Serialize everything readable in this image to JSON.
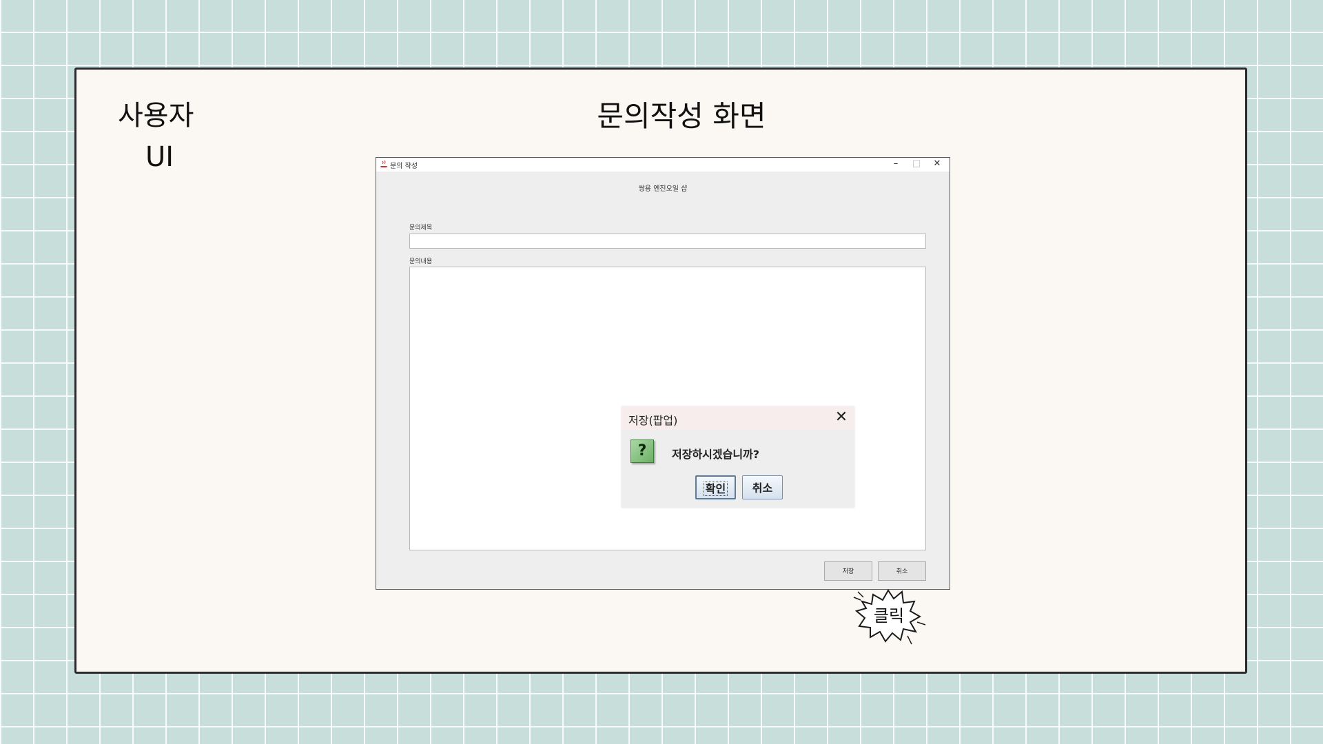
{
  "slide": {
    "label_line1": "사용자",
    "label_line2": "UI",
    "title": "문의작성 화면"
  },
  "window": {
    "title": "문의 작성",
    "controls": {
      "minimize": "–",
      "maximize": "□",
      "close": "✕"
    },
    "header": "쌍용 엔진오일 샵",
    "subject_label": "문의제목",
    "subject_value": "",
    "content_label": "문의내용",
    "content_value": "",
    "save_button": "저장",
    "cancel_button": "취소"
  },
  "dialog": {
    "title": "저장(팝업)",
    "close": "✕",
    "icon": "?",
    "message": "저장하시겠습니까?",
    "confirm_button": "확인",
    "cancel_button": "취소"
  },
  "annotation": {
    "text": "클릭"
  },
  "colors": {
    "background": "#c7dedb",
    "slide": "#fbf7f2",
    "dialog_titlebar": "#f7eded",
    "question_icon": "#6cb066"
  }
}
